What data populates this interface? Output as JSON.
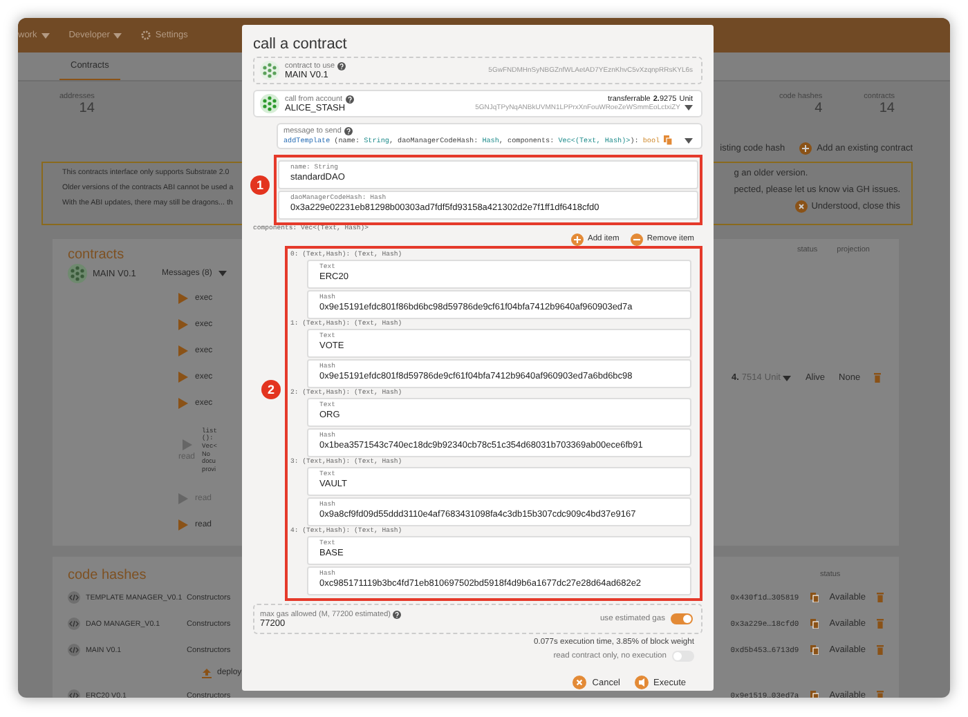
{
  "nav": [
    {
      "label": "work",
      "menu": true
    },
    {
      "label": "Developer",
      "menu": true
    },
    {
      "label": "Settings",
      "menu": false
    }
  ],
  "tabs": [
    {
      "label": "Contracts",
      "selected": true
    }
  ],
  "stats_left": [
    {
      "label": "addresses",
      "value": "14"
    }
  ],
  "stats_right": [
    {
      "label": "code hashes",
      "value": "4"
    },
    {
      "label": "contracts",
      "value": "14"
    }
  ],
  "actions": [
    {
      "label": "isting code hash",
      "icon": false
    },
    {
      "label": "Add an existing contract",
      "icon": true
    }
  ],
  "notice": {
    "lines_left": [
      "This contracts interface only supports Substrate 2.0",
      "Older versions of the contracts ABI cannot be used a",
      "With the ABI updates, there may still be dragons... th"
    ],
    "lines_right": [
      "g an older version.",
      "pected, please let us know via GH issues."
    ],
    "dismiss": "Understood, close this"
  },
  "contracts_card": {
    "title": "contracts",
    "columns": [
      "status",
      "projection"
    ],
    "contract": {
      "name": "MAIN V0.1",
      "messages_label": "Messages (8)"
    },
    "messages": [
      {
        "action": "exec",
        "enabled": true
      },
      {
        "action": "exec",
        "enabled": true
      },
      {
        "action": "exec",
        "enabled": true
      },
      {
        "action": "exec",
        "enabled": true
      },
      {
        "action": "exec",
        "enabled": true
      },
      {
        "action": "read",
        "enabled": false,
        "doc": [
          "list",
          "():",
          "Vec<",
          "No",
          "docu",
          "provi"
        ]
      },
      {
        "action": "read",
        "enabled": false
      },
      {
        "action": "read",
        "enabled": true
      }
    ],
    "balance_whole": "4.",
    "balance_fraction": "7514",
    "balance_unit": "Unit",
    "status": "Alive",
    "projection": "None"
  },
  "code_hashes": {
    "title": "code hashes",
    "status_header": "status",
    "rows": [
      {
        "name": "TEMPLATE MANAGER_V0.1",
        "constructors": "Constructors",
        "hash": "0x430f1d…305819",
        "status": "Available"
      },
      {
        "name": "DAO MANAGER_V0.1",
        "constructors": "Constructors",
        "hash": "0x3a229e…18cfd0",
        "status": "Available"
      },
      {
        "name": "MAIN V0.1",
        "constructors": "Constructors",
        "hash": "0xd5b453…6713d9",
        "status": "Available",
        "deploy": "deploy"
      },
      {
        "name": "ERC20 V0.1",
        "constructors": "Constructors",
        "hash": "0x9e1519…03ed7a",
        "status": "Available"
      }
    ]
  },
  "modal": {
    "title": "call a contract",
    "contract": {
      "label": "contract to use",
      "name": "MAIN V0.1",
      "address": "5GwFNDMHnSyNBGZnfWLAetAD7YEznKhvC5vXzqnpRRsKYL6s"
    },
    "account": {
      "label": "call from account",
      "name": "ALICE_STASH",
      "transferrable_label": "transferrable",
      "whole": "2.",
      "fraction": "9275",
      "unit": "Unit",
      "address": "5GNJqTPyNqANBkUVMN1LPPrxXnFouWRoeZeWSmmEoLctxiZY"
    },
    "message": {
      "label": "message to send",
      "signature": [
        {
          "text": "addTemplate",
          "kind": "method"
        },
        {
          "text": " (name: ",
          "kind": "plain"
        },
        {
          "text": "String",
          "kind": "type"
        },
        {
          "text": ", daoManagerCodeHash: ",
          "kind": "plain"
        },
        {
          "text": "Hash",
          "kind": "type"
        },
        {
          "text": ", components: ",
          "kind": "plain"
        },
        {
          "text": "Vec<(Text, Hash)>",
          "kind": "type"
        },
        {
          "text": "): ",
          "kind": "plain"
        },
        {
          "text": "bool",
          "kind": "return"
        }
      ]
    },
    "params": {
      "badge": "1",
      "fields": [
        {
          "label": "name: String",
          "value": "standardDAO"
        },
        {
          "label": "daoManagerCodeHash: Hash",
          "value": "0x3a229e02231eb81298b00303ad7fdf5fd93158a421302d2e7f1ff1df6418cfd0"
        }
      ]
    },
    "components": {
      "label": "components: Vec<(Text, Hash)>",
      "add": "Add item",
      "remove": "Remove item",
      "badge": "2",
      "items": [
        {
          "header": "0: (Text,Hash): (Text, Hash)",
          "text_label": "Text",
          "text": "ERC20",
          "hash_label": "Hash",
          "hash": "0x9e15191efdc801f86bd6bc98d59786de9cf61f04bfa7412b9640af960903ed7a"
        },
        {
          "header": "1: (Text,Hash): (Text, Hash)",
          "text_label": "Text",
          "text": "VOTE",
          "hash_label": "Hash",
          "hash": "0x9e15191efdc801f8d59786de9cf61f04bfa7412b9640af960903ed7a6bd6bc98"
        },
        {
          "header": "2: (Text,Hash): (Text, Hash)",
          "text_label": "Text",
          "text": "ORG",
          "hash_label": "Hash",
          "hash": "0x1bea3571543c740ec18dc9b92340cb78c51c354d68031b703369ab00ece6fb91"
        },
        {
          "header": "3: (Text,Hash): (Text, Hash)",
          "text_label": "Text",
          "text": "VAULT",
          "hash_label": "Hash",
          "hash": "0x9a8cf9fd09d55ddd3110e4af7683431098fa4c3db15b307cdc909c4bd37e9167"
        },
        {
          "header": "4: (Text,Hash): (Text, Hash)",
          "text_label": "Text",
          "text": "BASE",
          "hash_label": "Hash",
          "hash": "0xc985171119b3bc4fd71eb810697502bd5918f4d9b6a1677dc27e28d64ad682e2"
        }
      ]
    },
    "gas": {
      "label": "max gas allowed (M, 77200 estimated)",
      "value": "77200",
      "toggle_label": "use estimated gas",
      "use_estimated": true
    },
    "execution_info": "0.077s execution time, 3.85% of block weight",
    "read_only": {
      "label": "read contract only, no execution",
      "on": false
    },
    "buttons": [
      {
        "label": "Cancel",
        "kind": "cancel"
      },
      {
        "label": "Execute",
        "kind": "execute"
      }
    ]
  }
}
